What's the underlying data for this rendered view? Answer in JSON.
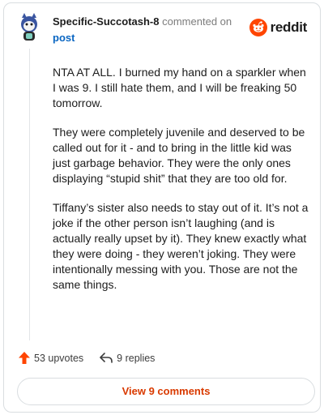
{
  "comment": {
    "username": "Specific-Succotash-8",
    "action_text": "commented on",
    "post_link": "post",
    "paragraphs": [
      "NTA AT ALL. I burned my hand on a sparkler when I was 9. I still hate them, and I will be freaking 50 tomorrow.",
      "They were completely juvenile and deserved to be called out for it - and to bring in the little kid was just garbage behavior. They were the only ones displaying “stupid shit” that they are too old for.",
      "Tiffany’s sister also needs to stay out of it. It’s not a joke if the other person isn’t laughing (and is actually really upset by it). They knew exactly what they were doing - they weren’t joking. They were intentionally messing with you. Those are not the same things."
    ]
  },
  "branding": {
    "logo_text": "reddit",
    "accent_color": "#ff4500"
  },
  "footer": {
    "upvotes": "53 upvotes",
    "replies": "9 replies",
    "view_button": "View 9 comments",
    "button_text_color": "#d93a00"
  },
  "icons": {
    "avatar": "snoo-avatar-icon",
    "logo": "reddit-logo-icon",
    "upvote": "upvote-arrow-icon",
    "reply": "reply-arrow-icon"
  }
}
